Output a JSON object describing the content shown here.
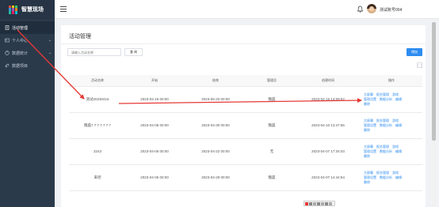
{
  "app": {
    "logo_text": "智慧现场",
    "brand_colors": [
      "#e74c3c",
      "#f1c40f",
      "#2ecc71",
      "#3498db",
      "#9b59b6",
      "#e67e22",
      "#1abc9c",
      "#e91e63",
      "#00bcd4"
    ]
  },
  "sidebar": {
    "items": [
      {
        "label": "活动管理",
        "icon": "document-icon",
        "active": true
      },
      {
        "label": "个人中心",
        "icon": "user-icon",
        "expandable": true
      },
      {
        "label": "数据统计",
        "icon": "chart-icon",
        "expandable": true
      },
      {
        "label": "数据项目",
        "icon": "link-icon"
      }
    ]
  },
  "topbar": {
    "menu_icon": "hamburger-icon",
    "bell_icon": "bell-icon",
    "username": "测试账号004"
  },
  "main": {
    "title": "活动管理",
    "search_placeholder": "请输入活动名称",
    "search_button": "查 询",
    "add_button": "增加",
    "columns_toggle": "⋮⋮",
    "columns": [
      "活动名称",
      "开始",
      "结束",
      "管理员",
      "创建时间",
      "操作"
    ],
    "rows": [
      {
        "name": "测试20230415",
        "start": "2023-04-19 00:00",
        "end": "2023-05-20 00:00",
        "admin": "魏晨",
        "created": "2023-04-16 14:09:52"
      },
      {
        "name": "魏晨7 7 7 7 7 7 7",
        "start": "2023-04-06 00:00",
        "end": "2023-04-30 00:00",
        "admin": "魏晨",
        "created": "2023-04-10 13:47:56"
      },
      {
        "name": "3243",
        "start": "2023-04-05 00:00",
        "end": "2023-04-22 00:00",
        "admin": "无",
        "created": "2023-04-07 17:34:03"
      },
      {
        "name": "来吧",
        "start": "2023-04-06 00:00",
        "end": "2023-04-29 00:00",
        "admin": "魏晨",
        "created": "2023-04-07 14:44:54"
      }
    ],
    "ops": {
      "line1": [
        "大屏幕",
        "报名管理",
        "游戏"
      ],
      "line2": [
        "管理设置",
        "数据分析",
        "编辑"
      ],
      "line3": [
        "删除"
      ]
    }
  },
  "annotation_color": "#e53935",
  "accent_color": "#2d8cf0"
}
